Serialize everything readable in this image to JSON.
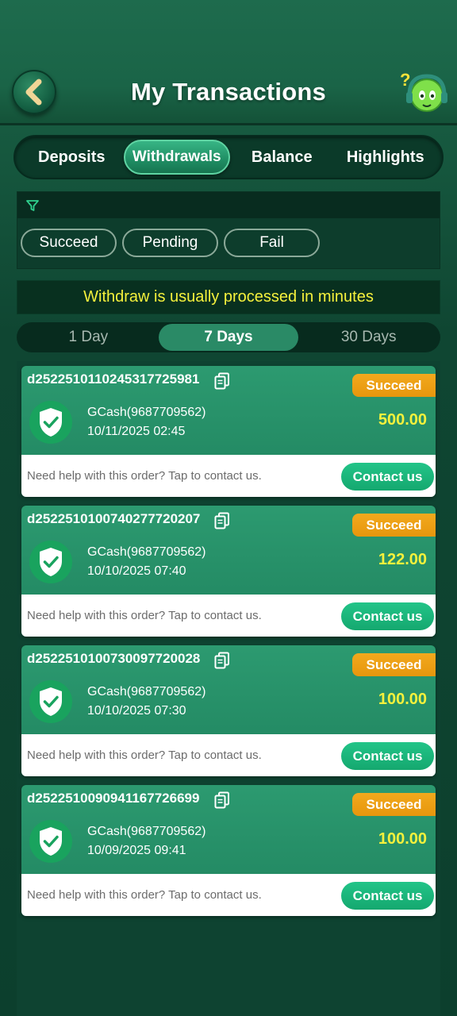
{
  "header": {
    "title": "My Transactions"
  },
  "tabs": [
    {
      "label": "Deposits",
      "active": false
    },
    {
      "label": "Withdrawals",
      "active": true
    },
    {
      "label": "Balance",
      "active": false
    },
    {
      "label": "Highlights",
      "active": false
    }
  ],
  "filters": {
    "chips": [
      "Succeed",
      "Pending",
      "Fail"
    ]
  },
  "notice": "Withdraw is usually processed in minutes",
  "range": {
    "options": [
      "1 Day",
      "7 Days",
      "30 Days"
    ],
    "selected": "7 Days"
  },
  "transactions": [
    {
      "order_id": "d2522510110245317725981",
      "status": "Succeed",
      "method": "GCash(9687709562)",
      "time": "10/11/2025 02:45",
      "amount": "500.00"
    },
    {
      "order_id": "d2522510100740277720207",
      "status": "Succeed",
      "method": "GCash(9687709562)",
      "time": "10/10/2025 07:40",
      "amount": "122.00"
    },
    {
      "order_id": "d2522510100730097720028",
      "status": "Succeed",
      "method": "GCash(9687709562)",
      "time": "10/10/2025 07:30",
      "amount": "100.00"
    },
    {
      "order_id": "d2522510090941167726699",
      "status": "Succeed",
      "method": "GCash(9687709562)",
      "time": "10/09/2025 09:41",
      "amount": "100.00"
    }
  ],
  "help_text": "Need help with this order? Tap to contact us.",
  "contact_label": "Contact us",
  "colors": {
    "accent_yellow": "#f5f13c",
    "badge_orange": "#ee9f14",
    "contact_green": "#1cb87d"
  }
}
